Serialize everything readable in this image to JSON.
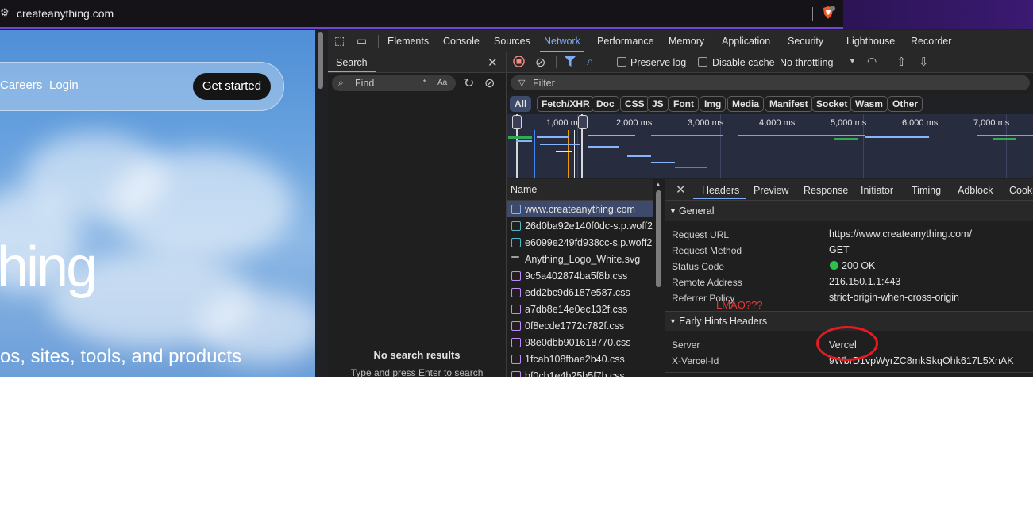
{
  "browser": {
    "url": "createanything.com"
  },
  "website": {
    "nav_careers": "Careers",
    "nav_login": "Login",
    "get_started": "Get started",
    "hero_fragment": "hing",
    "subtitle_fragment": "os, sites, tools, and products"
  },
  "devtools": {
    "tabs": [
      "Elements",
      "Console",
      "Sources",
      "Network",
      "Performance",
      "Memory",
      "Application",
      "Security",
      "Lighthouse",
      "Recorder"
    ],
    "search": {
      "tab": "Search",
      "placeholder": "Find",
      "regex_toggle": ".*",
      "case_toggle": "Aa",
      "no_results": "No search results",
      "hint": "Type and press Enter to search"
    },
    "network": {
      "preserve_log": "Preserve log",
      "disable_cache": "Disable cache",
      "throttling": "No throttling",
      "filter_placeholder": "Filter",
      "filter_chips": [
        "All",
        "Fetch/XHR",
        "Doc",
        "CSS",
        "JS",
        "Font",
        "Img",
        "Media",
        "Manifest",
        "Socket",
        "Wasm",
        "Other"
      ],
      "timeline_ticks": [
        "1,000 ms",
        "2,000 ms",
        "3,000 ms",
        "4,000 ms",
        "5,000 ms",
        "6,000 ms",
        "7,000 ms"
      ],
      "name_header": "Name",
      "requests": [
        "www.createanything.com",
        "26d0ba92e140f0dc-s.p.woff2",
        "e6099e249fd938cc-s.p.woff2",
        "Anything_Logo_White.svg",
        "9c5a402874ba5f8b.css",
        "edd2bc9d6187e587.css",
        "a7db8e14e0ec132f.css",
        "0f8ecde1772c782f.css",
        "98e0dbb901618770.css",
        "1fcab108fbae2b40.css",
        "bf0cb1e4b25b5f7b.css"
      ]
    },
    "details": {
      "tabs": [
        "Headers",
        "Preview",
        "Response",
        "Initiator",
        "Timing",
        "Adblock",
        "Cooki"
      ],
      "general_title": "General",
      "general": [
        {
          "key": "Request URL",
          "value": "https://www.createanything.com/"
        },
        {
          "key": "Request Method",
          "value": "GET"
        },
        {
          "key": "Status Code",
          "value": "200 OK"
        },
        {
          "key": "Remote Address",
          "value": "216.150.1.1:443"
        },
        {
          "key": "Referrer Policy",
          "value": "strict-origin-when-cross-origin"
        }
      ],
      "early_hints_title": "Early Hints Headers",
      "early_hints": [
        {
          "key": "Server",
          "value": "Vercel"
        },
        {
          "key": "X-Vercel-Id",
          "value": "9WbrD1vpWyrZC8mkSkqOhk617L5XnAK"
        }
      ]
    },
    "annotation": "LMAO???"
  },
  "colors": {
    "accent": "#7cacf8",
    "status_ok": "#2fbf4a",
    "annotation_red": "#e31b23"
  }
}
